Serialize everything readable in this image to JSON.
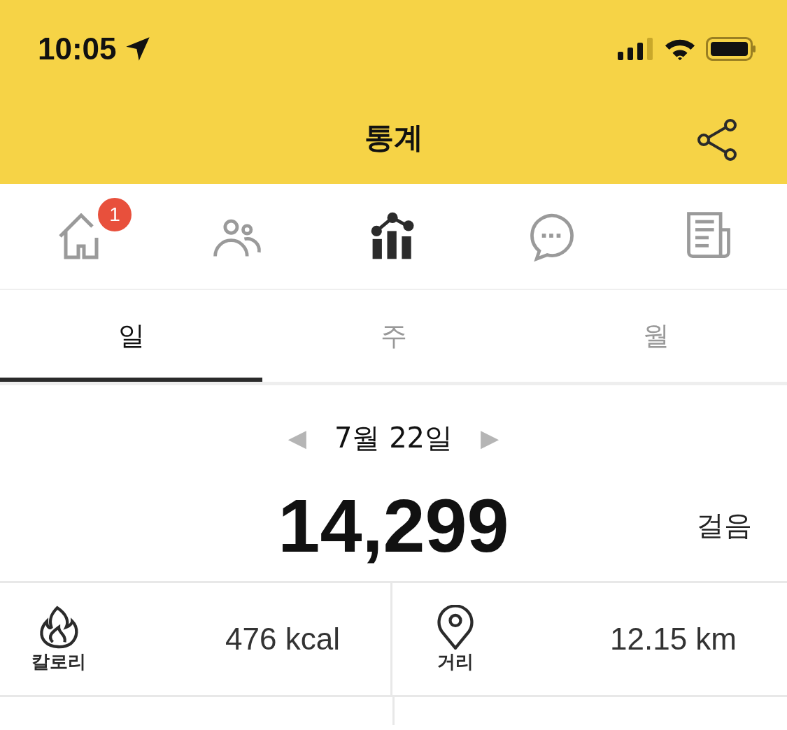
{
  "status_bar": {
    "time": "10:05"
  },
  "header": {
    "title": "통계"
  },
  "nav": [
    {
      "kind": "home",
      "selected": false,
      "badge": "1"
    },
    {
      "kind": "friends",
      "selected": false
    },
    {
      "kind": "stats",
      "selected": true
    },
    {
      "kind": "chat",
      "selected": false
    },
    {
      "kind": "news",
      "selected": false
    }
  ],
  "tabs": [
    {
      "label": "일",
      "selected": true
    },
    {
      "label": "주",
      "selected": false
    },
    {
      "label": "월",
      "selected": false
    }
  ],
  "date": {
    "prev": "◀",
    "label": "7월 22일",
    "next": "▶"
  },
  "steps": {
    "value": "14,299",
    "unit": "걸음"
  },
  "stats": [
    {
      "kind": "calories",
      "label": "칼로리",
      "value": "476 kcal"
    },
    {
      "kind": "distance",
      "label": "거리",
      "value": "12.15 km"
    }
  ]
}
